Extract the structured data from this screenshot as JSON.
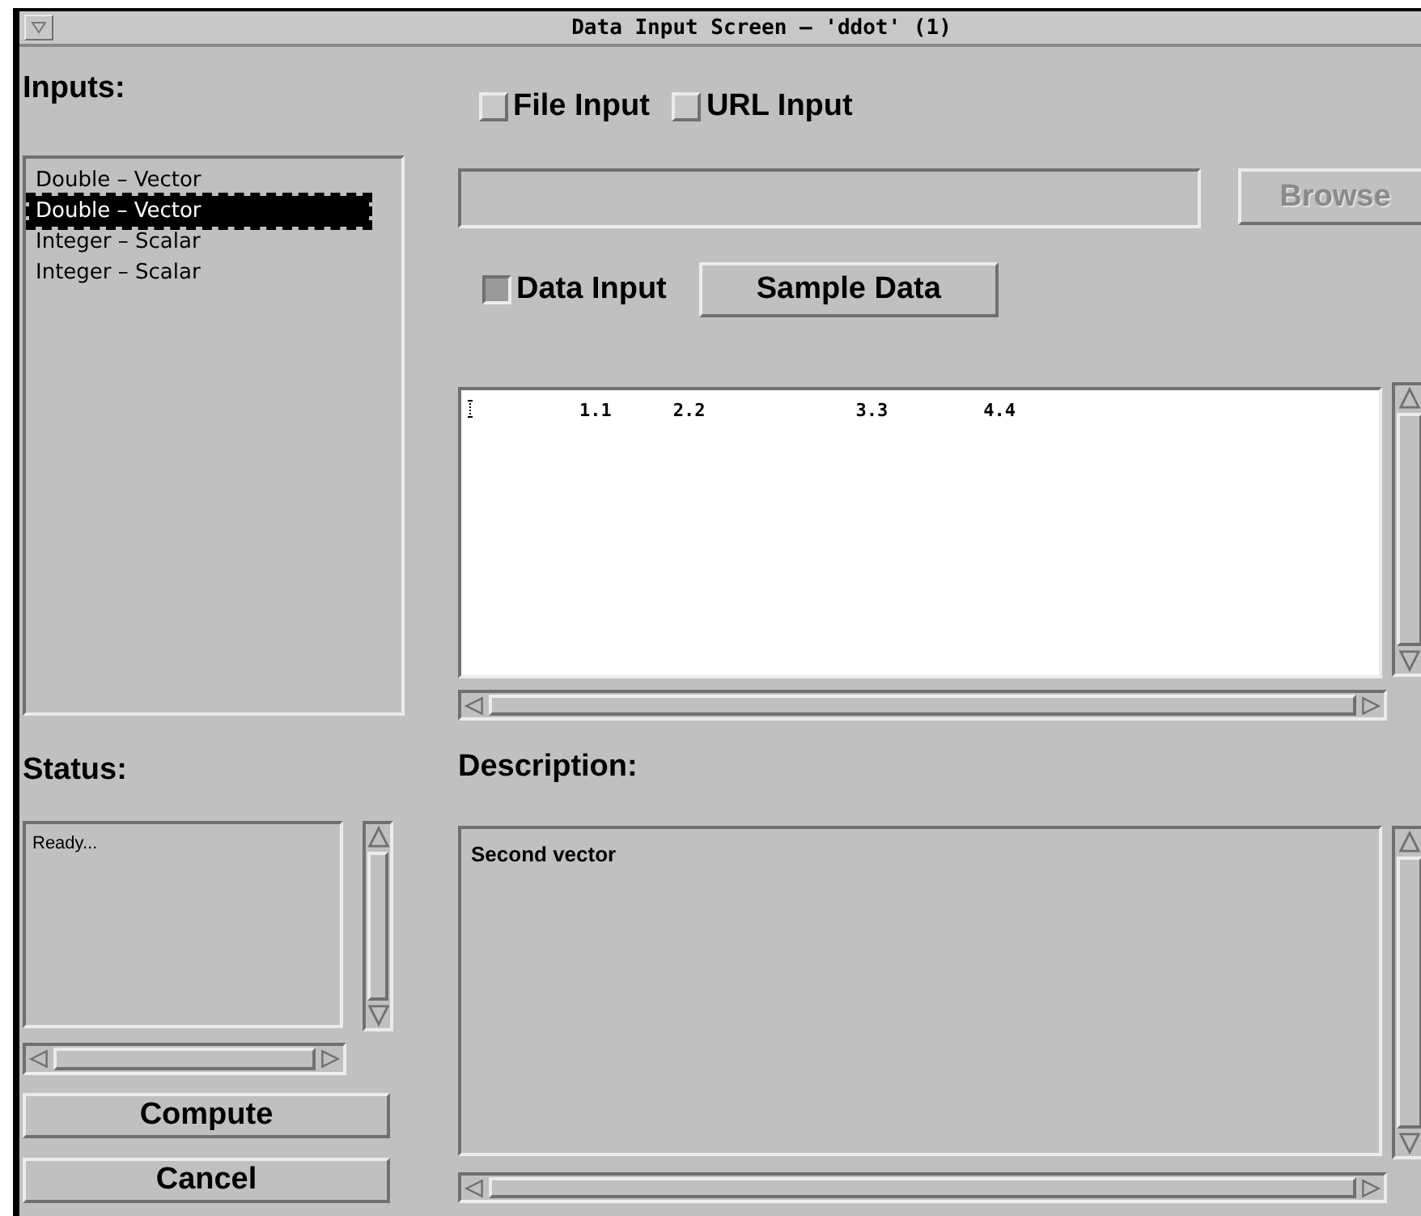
{
  "window": {
    "title": "Data Input Screen – 'ddot' (1)"
  },
  "inputs": {
    "heading": "Inputs:",
    "items": [
      {
        "label": "Double – Vector",
        "selected": false
      },
      {
        "label": "Double – Vector",
        "selected": true
      },
      {
        "label": "Integer – Scalar",
        "selected": false
      },
      {
        "label": "Integer – Scalar",
        "selected": false
      }
    ]
  },
  "status": {
    "heading": "Status:",
    "text": "Ready..."
  },
  "buttons": [
    {
      "label": "Compute"
    },
    {
      "label": "Cancel"
    }
  ],
  "source_toggles": [
    {
      "label": "File Input",
      "checked": false
    },
    {
      "label": "URL Input",
      "checked": false
    }
  ],
  "browse_button": {
    "label": "Browse",
    "disabled": true
  },
  "data_toggle": {
    "label": "Data Input",
    "checked": true
  },
  "sample_button": {
    "label": "Sample Data"
  },
  "data_values": [
    "1.1",
    "2.2",
    "3.3",
    "4.4"
  ],
  "description": {
    "heading": "Description:",
    "text": "Second vector"
  }
}
